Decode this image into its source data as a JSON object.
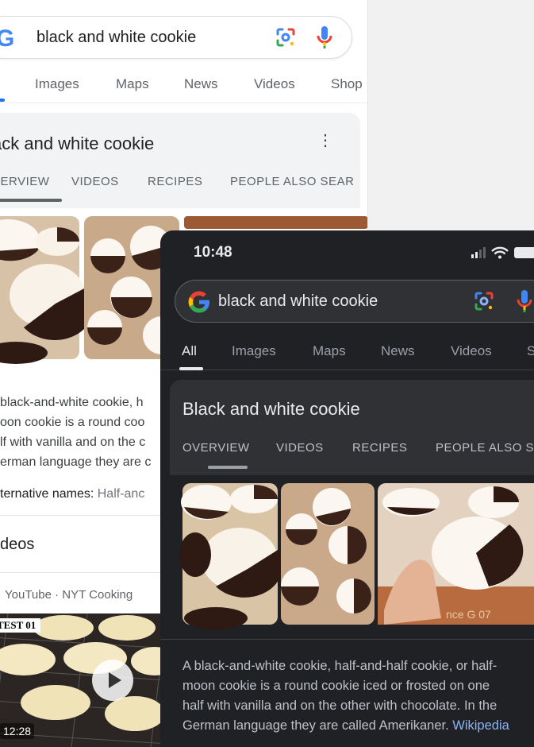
{
  "light": {
    "query": "black and white cookie",
    "tabs": [
      "Images",
      "Maps",
      "News",
      "Videos",
      "Shop"
    ],
    "card_title": "ack and white cookie",
    "subtabs": [
      "VERVIEW",
      "VIDEOS",
      "RECIPES",
      "PEOPLE ALSO SEAR"
    ],
    "desc_lines": [
      "black-and-white cookie, h",
      "oon cookie is a round coo",
      "lf with vanilla and on the c",
      "erman language they are c"
    ],
    "alt_label": "ternative names:",
    "alt_value": "Half-anc",
    "videos_heading": "deos",
    "video_source": "YouTube · NYT Cooking",
    "video_badge": "TEST 01",
    "video_duration": "12:28"
  },
  "dark": {
    "time": "10:48",
    "query": "black and white cookie",
    "tabs": [
      "All",
      "Images",
      "Maps",
      "News",
      "Videos",
      "S"
    ],
    "card_title": "Black and white cookie",
    "subtabs": [
      "OVERVIEW",
      "VIDEOS",
      "RECIPES",
      "PEOPLE ALSO SE"
    ],
    "desc_lines": [
      "A black-and-white cookie, half-and-half cookie, or half-",
      "moon cookie is a round cookie iced or frosted on one",
      "half with vanilla and on the other with chocolate. In the",
      "German language they are called Amerikaner. "
    ],
    "wiki_link": "Wikipedia",
    "tray_text": "nce G 07"
  },
  "colors": {
    "google_blue": "#4285F4",
    "google_red": "#EA4335",
    "google_yellow": "#FBBC05",
    "google_green": "#34A853",
    "link_dark": "#8ab4f8",
    "tab_active_light": "#1a73e8"
  },
  "icons": [
    "google-g-icon",
    "lens-icon",
    "mic-icon",
    "more-vert-icon",
    "play-icon",
    "signal-icon",
    "wifi-icon",
    "battery-icon"
  ]
}
